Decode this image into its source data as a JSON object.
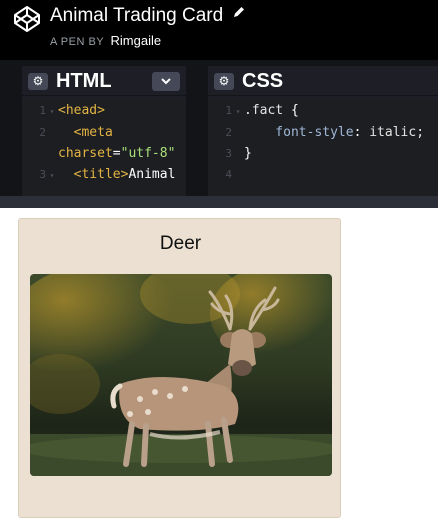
{
  "header": {
    "title": "Animal Trading Card",
    "byline_prefix": "A PEN BY",
    "author": "Rimgaile"
  },
  "html_editor": {
    "title": "HTML",
    "lines": [
      {
        "num": "1",
        "fold": "▾",
        "parts": [
          {
            "c": "tag",
            "t": "<head>"
          }
        ]
      },
      {
        "num": "2",
        "fold": "",
        "parts": [
          {
            "c": "tag",
            "t": "  <meta"
          }
        ]
      },
      {
        "num": "",
        "fold": "",
        "parts": [
          {
            "c": "attr",
            "t": "charset"
          },
          {
            "c": "txt",
            "t": "="
          },
          {
            "c": "str",
            "t": "\"utf-8\""
          }
        ]
      },
      {
        "num": "3",
        "fold": "▾",
        "parts": [
          {
            "c": "tag",
            "t": "  <title>"
          },
          {
            "c": "txt",
            "t": "Animal"
          }
        ]
      }
    ]
  },
  "css_editor": {
    "title": "CSS",
    "lines": [
      {
        "num": "1",
        "fold": "▾",
        "parts": [
          {
            "c": "sel",
            "t": ".fact "
          },
          {
            "c": "txt",
            "t": "{"
          }
        ]
      },
      {
        "num": "2",
        "fold": "",
        "parts": [
          {
            "c": "prop",
            "t": "    font-style"
          },
          {
            "c": "txt",
            "t": ": "
          },
          {
            "c": "val",
            "t": "italic;"
          }
        ]
      },
      {
        "num": "3",
        "fold": "",
        "parts": [
          {
            "c": "txt",
            "t": "}"
          }
        ]
      },
      {
        "num": "4",
        "fold": "",
        "parts": []
      }
    ]
  },
  "preview": {
    "card_name": "Deer",
    "photo_icon": "deer-photo"
  },
  "colors": {
    "topbar": "#000000",
    "editor_bg": "#1e1f26",
    "card_bg": "#ebe0d2"
  }
}
